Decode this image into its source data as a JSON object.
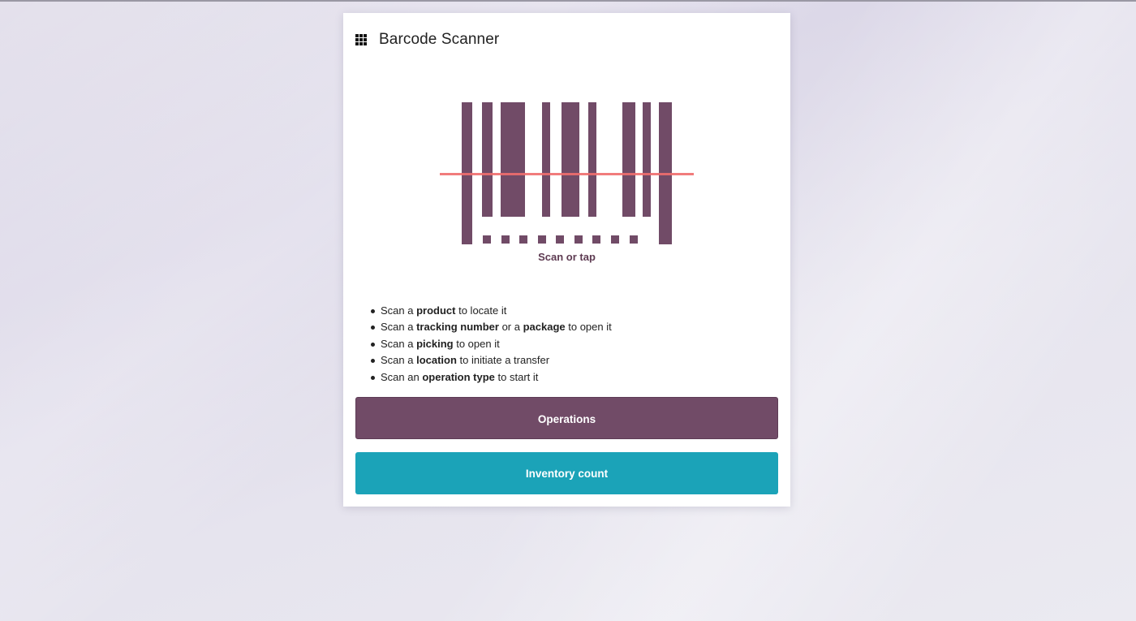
{
  "app": {
    "title": "Barcode Scanner",
    "menu_icon": "apps-grid-icon"
  },
  "scanner": {
    "label": "Scan or tap",
    "bar_color": "#714b67",
    "scanline_color": "#f06e6e"
  },
  "instructions": [
    {
      "before": "Scan a ",
      "bold": "product",
      "after": " to locate it"
    },
    {
      "before": "Scan a ",
      "bold": "tracking number",
      "middle": " or a ",
      "bold2": "package",
      "after": " to open it"
    },
    {
      "before": "Scan a ",
      "bold": "picking",
      "after": " to open it"
    },
    {
      "before": "Scan a ",
      "bold": "location",
      "after": " to initiate a transfer"
    },
    {
      "before": "Scan an ",
      "bold": "operation type",
      "after": " to start it"
    }
  ],
  "buttons": {
    "operations": {
      "label": "Operations",
      "color": "#714b67"
    },
    "inventory": {
      "label": "Inventory count",
      "color": "#1ba3b8"
    }
  }
}
